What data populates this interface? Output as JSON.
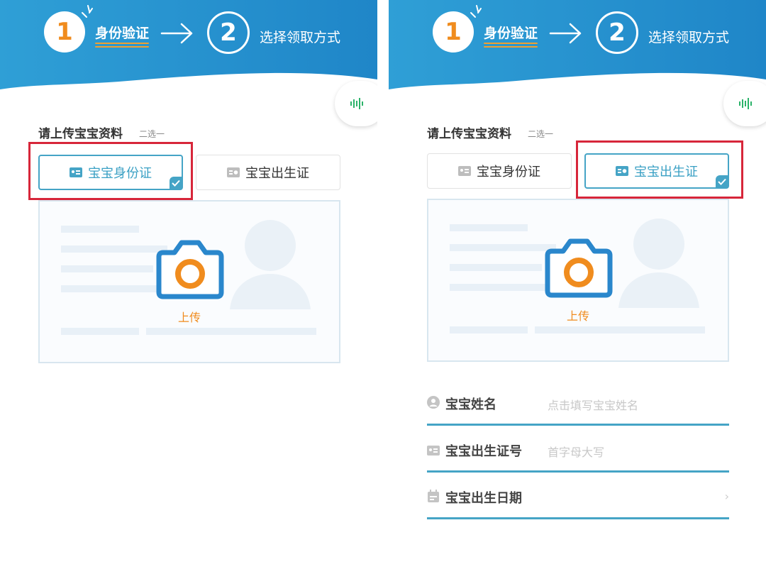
{
  "colors": {
    "header_blue": "#2f9fd6",
    "header_blue_dark": "#1f86c8",
    "accent_orange": "#f08c1e",
    "active_teal": "#45a4c6",
    "highlight_red": "#d7263a",
    "voice_green": "#2cb36a"
  },
  "screens": [
    {
      "steps": {
        "step1": {
          "number": "1",
          "label": "身份验证"
        },
        "step2": {
          "number": "2",
          "label": "选择领取方式"
        }
      },
      "upload_section": {
        "title": "请上传宝宝资料",
        "subtitle": "二选一"
      },
      "tabs": [
        {
          "label": "宝宝身份证",
          "icon": "id-card-icon",
          "selected": true
        },
        {
          "label": "宝宝出生证",
          "icon": "birth-certificate-icon",
          "selected": false
        }
      ],
      "upload": {
        "label": "上传"
      }
    },
    {
      "steps": {
        "step1": {
          "number": "1",
          "label": "身份验证"
        },
        "step2": {
          "number": "2",
          "label": "选择领取方式"
        }
      },
      "upload_section": {
        "title": "请上传宝宝资料",
        "subtitle": "二选一"
      },
      "tabs": [
        {
          "label": "宝宝身份证",
          "icon": "id-card-icon",
          "selected": false
        },
        {
          "label": "宝宝出生证",
          "icon": "birth-certificate-icon",
          "selected": true
        }
      ],
      "upload": {
        "label": "上传"
      },
      "form": [
        {
          "label": "宝宝姓名",
          "placeholder": "点击填写宝宝姓名",
          "icon": "person-icon"
        },
        {
          "label": "宝宝出生证号",
          "placeholder": "首字母大写",
          "icon": "id-card-icon"
        },
        {
          "label": "宝宝出生日期",
          "placeholder": "",
          "icon": "calendar-icon",
          "chevron": "›"
        }
      ]
    }
  ]
}
